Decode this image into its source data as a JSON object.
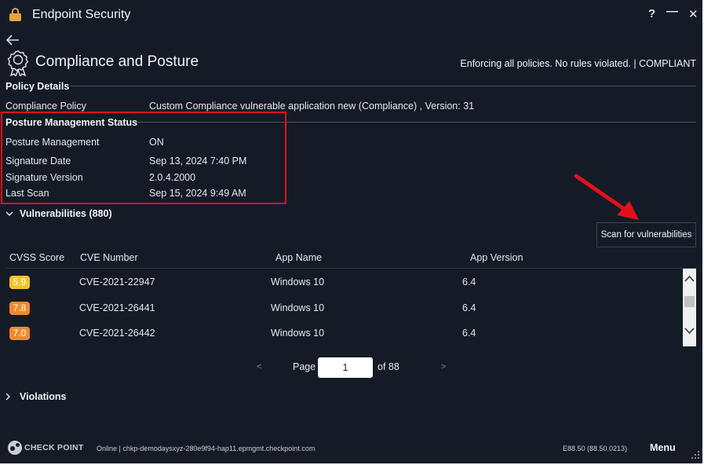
{
  "window": {
    "title": "Endpoint Security",
    "help_label": "?",
    "minimize_label": "—",
    "close_label": "✕"
  },
  "header": {
    "title": "Compliance and Posture",
    "status": "Enforcing all policies. No rules violated. | COMPLIANT"
  },
  "policy_details": {
    "title": "Policy Details",
    "rows": [
      {
        "label": "Compliance Policy",
        "value": "Custom Compliance vulnerable application new (Compliance) , Version: 31"
      }
    ]
  },
  "posture": {
    "title": "Posture Management Status",
    "rows": [
      {
        "label": "Posture Management",
        "value": "ON"
      },
      {
        "label": "Signature Date",
        "value": "Sep 13, 2024 7:40 PM"
      },
      {
        "label": "Signature Version",
        "value": "2.0.4.2000"
      },
      {
        "label": "Last Scan",
        "value": "Sep 15, 2024 9:49 AM"
      }
    ],
    "highlight_color": "#e3101b"
  },
  "vulnerabilities": {
    "title": "Vulnerabilities (880)",
    "scan_button": "Scan for vulnerabilities",
    "columns": [
      "CVSS Score",
      "CVE Number",
      "App Name",
      "App Version"
    ],
    "rows": [
      {
        "score": "5.9",
        "score_color": "#f2c12e",
        "cve": "CVE-2021-22947",
        "app": "Windows 10",
        "version": "6.4"
      },
      {
        "score": "7.8",
        "score_color": "#f08a2c",
        "cve": "CVE-2021-26441",
        "app": "Windows 10",
        "version": "6.4"
      },
      {
        "score": "7.0",
        "score_color": "#f08a2c",
        "cve": "CVE-2021-26442",
        "app": "Windows 10",
        "version": "6.4"
      }
    ],
    "pager": {
      "prev": "<",
      "label": "Page",
      "current": "1",
      "total": "of 88",
      "next": ">"
    }
  },
  "violations": {
    "title": "Violations"
  },
  "footer": {
    "brand": "CHECK POINT",
    "status": "Online  |  chkp-demodaysxyz-280e9f94-hap11.epmgmt.checkpoint.com",
    "version": "E88.50   (88.50.0213)",
    "menu": "Menu"
  },
  "colors": {
    "background": "#141b27",
    "annotation_red": "#e3101b"
  }
}
